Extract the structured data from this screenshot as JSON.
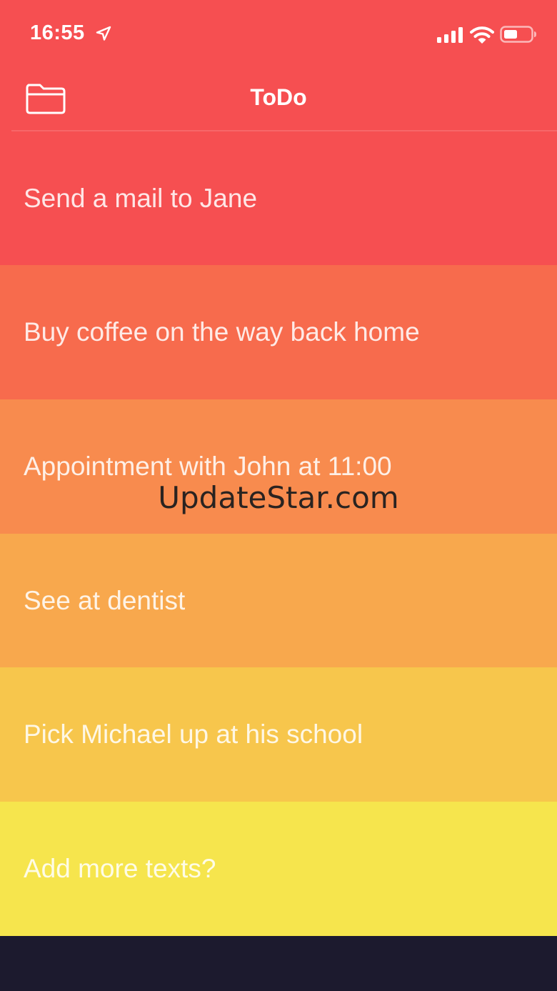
{
  "status_bar": {
    "time": "16:55",
    "icons": [
      "location-arrow-icon",
      "cellular-signal-icon",
      "wifi-icon",
      "battery-icon"
    ]
  },
  "nav": {
    "title": "ToDo",
    "left_icon": "folder-icon"
  },
  "colors": {
    "header": "#f64f51",
    "bottom": "#1c1a2e",
    "text": "#ffffff"
  },
  "todos": [
    {
      "text": "Send a mail to Jane",
      "color": "#f64f51"
    },
    {
      "text": "Buy coffee on the way back home",
      "color": "#f76b4d"
    },
    {
      "text": "Appointment with John at 11:00",
      "color": "#f88b4e"
    },
    {
      "text": "See at dentist",
      "color": "#f8a84d"
    },
    {
      "text": "Pick Michael up at his school",
      "color": "#f7c64c"
    },
    {
      "text": "Add more texts?",
      "color": "#f6e54d"
    }
  ],
  "watermark": "UpdateStar.com"
}
